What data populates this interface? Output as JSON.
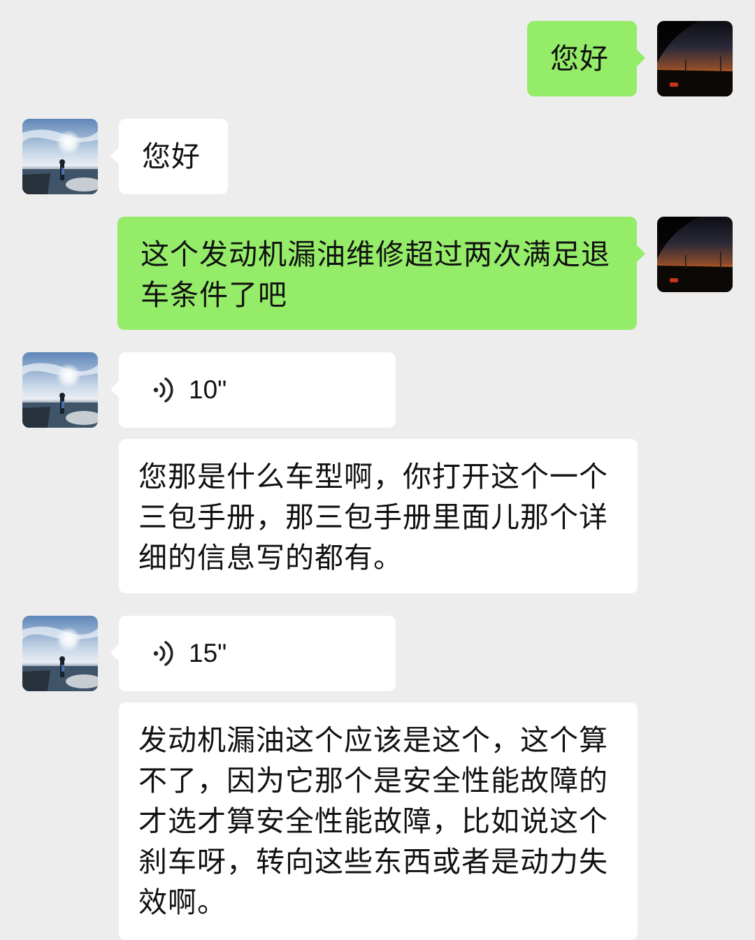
{
  "colors": {
    "background": "#ededed",
    "my_bubble": "#95ec69",
    "other_bubble": "#ffffff",
    "text": "#111111"
  },
  "chat": {
    "messages": [
      {
        "sender": "me",
        "type": "text",
        "text": "您好",
        "avatar": "sunset-road-avatar"
      },
      {
        "sender": "other",
        "type": "text",
        "text": "您好",
        "avatar": "seaside-person-avatar"
      },
      {
        "sender": "me",
        "type": "text",
        "text": "这个发动机漏油维修超过两次满足退车条件了吧",
        "avatar": "sunset-road-avatar"
      },
      {
        "sender": "other",
        "type": "voice",
        "duration": "10\"",
        "icon": "voice-wave-icon",
        "avatar": "seaside-person-avatar"
      },
      {
        "sender": "other",
        "type": "transcript",
        "text": "您那是什么车型啊，你打开这个一个三包手册，那三包手册里面儿那个详细的信息写的都有。"
      },
      {
        "sender": "other",
        "type": "voice",
        "duration": "15\"",
        "icon": "voice-wave-icon",
        "avatar": "seaside-person-avatar"
      },
      {
        "sender": "other",
        "type": "transcript",
        "text": "发动机漏油这个应该是这个，这个算不了，因为它那个是安全性能故障的才选才算安全性能故障，比如说这个刹车呀，转向这些东西或者是动力失效啊。"
      }
    ]
  }
}
